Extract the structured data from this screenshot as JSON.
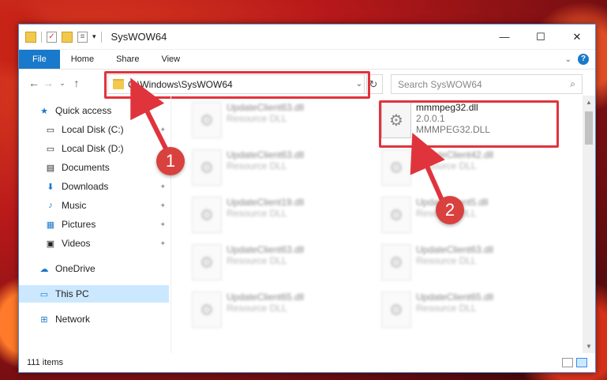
{
  "window": {
    "title": "SysWOW64",
    "controls": [
      "—",
      "☐",
      "✕"
    ]
  },
  "ribbon": {
    "tabs": [
      "File",
      "Home",
      "Share",
      "View"
    ],
    "help": "?"
  },
  "address": {
    "path": "C:\\Windows\\SysWOW64"
  },
  "search": {
    "placeholder": "Search SysWOW64"
  },
  "nav": {
    "items": [
      {
        "label": "Quick access",
        "icon": "star-icon"
      },
      {
        "label": "Local Disk (C:)",
        "icon": "drive-icon"
      },
      {
        "label": "Local Disk (D:)",
        "icon": "drive-icon"
      },
      {
        "label": "Documents",
        "icon": "documents-icon"
      },
      {
        "label": "Downloads",
        "icon": "downloads-icon"
      },
      {
        "label": "Music",
        "icon": "music-icon"
      },
      {
        "label": "Pictures",
        "icon": "pictures-icon"
      },
      {
        "label": "Videos",
        "icon": "videos-icon"
      },
      {
        "label": "OneDrive",
        "icon": "cloud-icon"
      },
      {
        "label": "This PC",
        "icon": "computer-icon"
      },
      {
        "label": "Network",
        "icon": "network-icon"
      }
    ]
  },
  "files": [
    {
      "name": "UpdateClient63.dll",
      "sub": "Resource DLL"
    },
    {
      "name": "mmmpeg32.dll",
      "sub": "2.0.0.1",
      "sub2": "MMMPEG32.DLL"
    },
    {
      "name": "UpdateClient63.dll",
      "sub": "Resource DLL"
    },
    {
      "name": "UpdateClient42.dll",
      "sub": "Resource DLL"
    },
    {
      "name": "UpdateClient19.dll",
      "sub": "Resource DLL"
    },
    {
      "name": "UpdateClient5.dll",
      "sub": "Resource DLL"
    },
    {
      "name": "UpdateClient63.dll",
      "sub": "Resource DLL"
    },
    {
      "name": "UpdateClient63.dll",
      "sub": "Resource DLL"
    },
    {
      "name": "UpdateClient65.dll",
      "sub": "Resource DLL"
    },
    {
      "name": "UpdateClient65.dll",
      "sub": "Resource DLL"
    }
  ],
  "status": {
    "count": "111 items"
  },
  "annotations": {
    "badge1": "1",
    "badge2": "2"
  },
  "colors": {
    "accent": "#1979ca",
    "highlight": "#e0343d",
    "selection": "#cce8ff"
  }
}
